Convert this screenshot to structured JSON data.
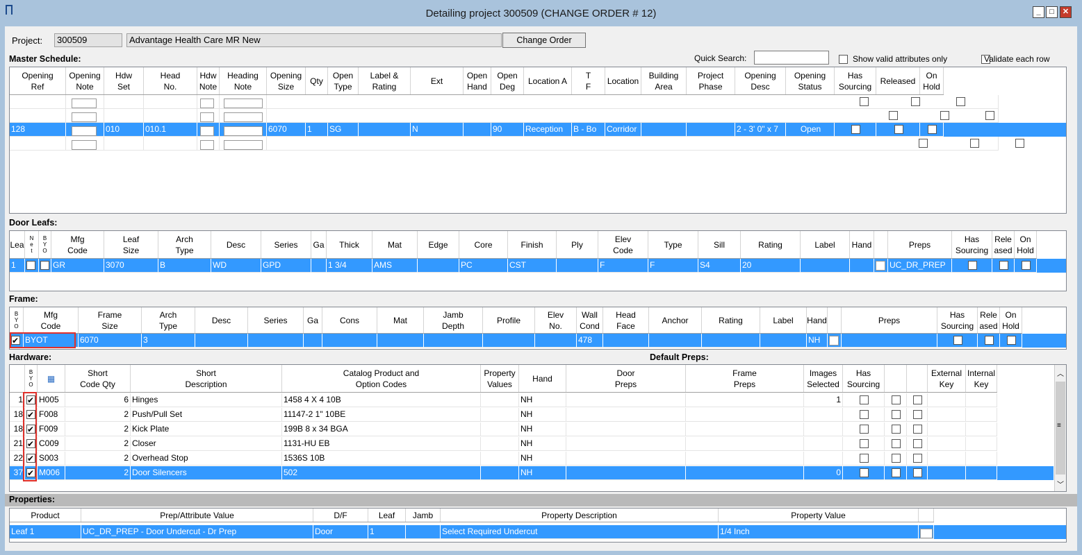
{
  "window": {
    "title": "Detailing project 300509   (CHANGE ORDER # 12)"
  },
  "project": {
    "label": "Project:",
    "number": "300509",
    "name": "Advantage Health Care MR New",
    "change_order_button": "Change Order"
  },
  "quick_search": {
    "label": "Quick Search:",
    "value": "",
    "show_valid_label": "Show valid attributes only",
    "validate_label": "Validate each row"
  },
  "master": {
    "title": "Master Schedule:",
    "headers": [
      "Opening\nRef",
      "Opening\nNote",
      "Hdw\nSet",
      "Head\nNo.",
      "Hdw\nNote",
      "Heading\nNote",
      "Opening\nSize",
      "Qty",
      "Open\nType",
      "Label &\nRating",
      "Ext",
      "Open\nHand",
      "Open\nDeg",
      "Location A",
      "T\nF",
      "Location",
      "Building\nArea",
      "Project\nPhase",
      "Opening\nDesc",
      "Opening\nStatus",
      "Has\nSourcing",
      "Released",
      "On\nHold"
    ],
    "selected": {
      "ref": "128",
      "hdw_set": "010",
      "head_no": "010.1",
      "size": "6070",
      "qty": "1",
      "type": "SG",
      "ext": "N",
      "deg": "90",
      "loc_a": "Reception",
      "tf": "B - Bo",
      "location": "Corridor",
      "desc": "2 - 3' 0\" x 7",
      "status": "Open"
    }
  },
  "leafs": {
    "title": "Door Leafs:",
    "headers": [
      "Lea",
      "N\ne\nt",
      "B\nY\nO",
      "Mfg\nCode",
      "Leaf\nSize",
      "Arch\nType",
      "Desc",
      "Series",
      "Ga",
      "Thick",
      "Mat",
      "Edge",
      "Core",
      "Finish",
      "Ply",
      "Elev\nCode",
      "Type",
      "Sill",
      "Rating",
      "Label",
      "Hand",
      "",
      "Preps",
      "Has\nSourcing",
      "Rele\nased",
      "On\nHold"
    ],
    "row": {
      "lea": "1",
      "mfg": "GR",
      "size": "3070",
      "arch": "B",
      "desc": "WD",
      "series": "GPD",
      "thick": "1 3/4",
      "mat": "AMS",
      "core": "PC",
      "finish": "CST",
      "elev": "F",
      "type": "F",
      "sill": "S4",
      "rating": "20",
      "preps": "UC_DR_PREP"
    }
  },
  "frame": {
    "title": "Frame:",
    "headers": [
      "B\nY\nO",
      "Mfg\nCode",
      "Frame\nSize",
      "Arch\nType",
      "Desc",
      "Series",
      "Ga",
      "Cons",
      "Mat",
      "Jamb\nDepth",
      "Profile",
      "Elev\nNo.",
      "Wall\nCond",
      "Head\nFace",
      "Anchor",
      "Rating",
      "Label",
      "Hand",
      "",
      "Preps",
      "Has\nSourcing",
      "Rele\nased",
      "On\nHold"
    ],
    "row": {
      "mfg": "BYOT",
      "size": "6070",
      "arch": "3",
      "wall": "478",
      "hand": "NH"
    }
  },
  "hardware": {
    "title": "Hardware:",
    "default_preps": "Default Preps:",
    "headers": [
      "",
      "B\nY\nO",
      "",
      "Short\nCode Qty",
      "Short\nDescription",
      "Catalog Product and\nOption Codes",
      "Property\nValues",
      "Hand",
      "Door\nPreps",
      "Frame\nPreps",
      "Images\nSelected",
      "Has\nSourcing",
      "",
      "",
      "External\nKey",
      "Internal\nKey"
    ],
    "rows": [
      {
        "n": "1",
        "code": "H005",
        "qty": "6",
        "desc": "Hinges",
        "cat": "1458 4 X 4 10B",
        "hand": "NH",
        "img": "1"
      },
      {
        "n": "18",
        "code": "F008",
        "qty": "2",
        "desc": "Push/Pull Set",
        "cat": "11147-2 1\" 10BE",
        "hand": "NH",
        "img": ""
      },
      {
        "n": "18",
        "code": "F009",
        "qty": "2",
        "desc": "Kick Plate",
        "cat": "199B 8 x 34 BGA",
        "hand": "NH",
        "img": ""
      },
      {
        "n": "21",
        "code": "C009",
        "qty": "2",
        "desc": "Closer",
        "cat": "1131-HU EB",
        "hand": "NH",
        "img": ""
      },
      {
        "n": "22",
        "code": "S003",
        "qty": "2",
        "desc": "Overhead Stop",
        "cat": "1536S 10B",
        "hand": "NH",
        "img": ""
      },
      {
        "n": "37",
        "code": "M006",
        "qty": "2",
        "desc": "Door Silencers",
        "cat": "502",
        "hand": "NH",
        "img": "0"
      }
    ]
  },
  "properties": {
    "title": "Properties:",
    "headers": [
      "Product",
      "Prep/Attribute Value",
      "D/F",
      "Leaf",
      "Jamb",
      "Property Description",
      "Property Value"
    ],
    "row": {
      "product": "Leaf 1",
      "prep": "UC_DR_PREP - Door Undercut - Dr Prep",
      "df": "Door",
      "leaf": "1",
      "jamb": "",
      "desc": "Select Required Undercut",
      "value": "1/4 Inch"
    }
  },
  "colors": {
    "selection": "#3399ff",
    "frame": "#a9c3dc",
    "highlight": "#e0302a"
  }
}
